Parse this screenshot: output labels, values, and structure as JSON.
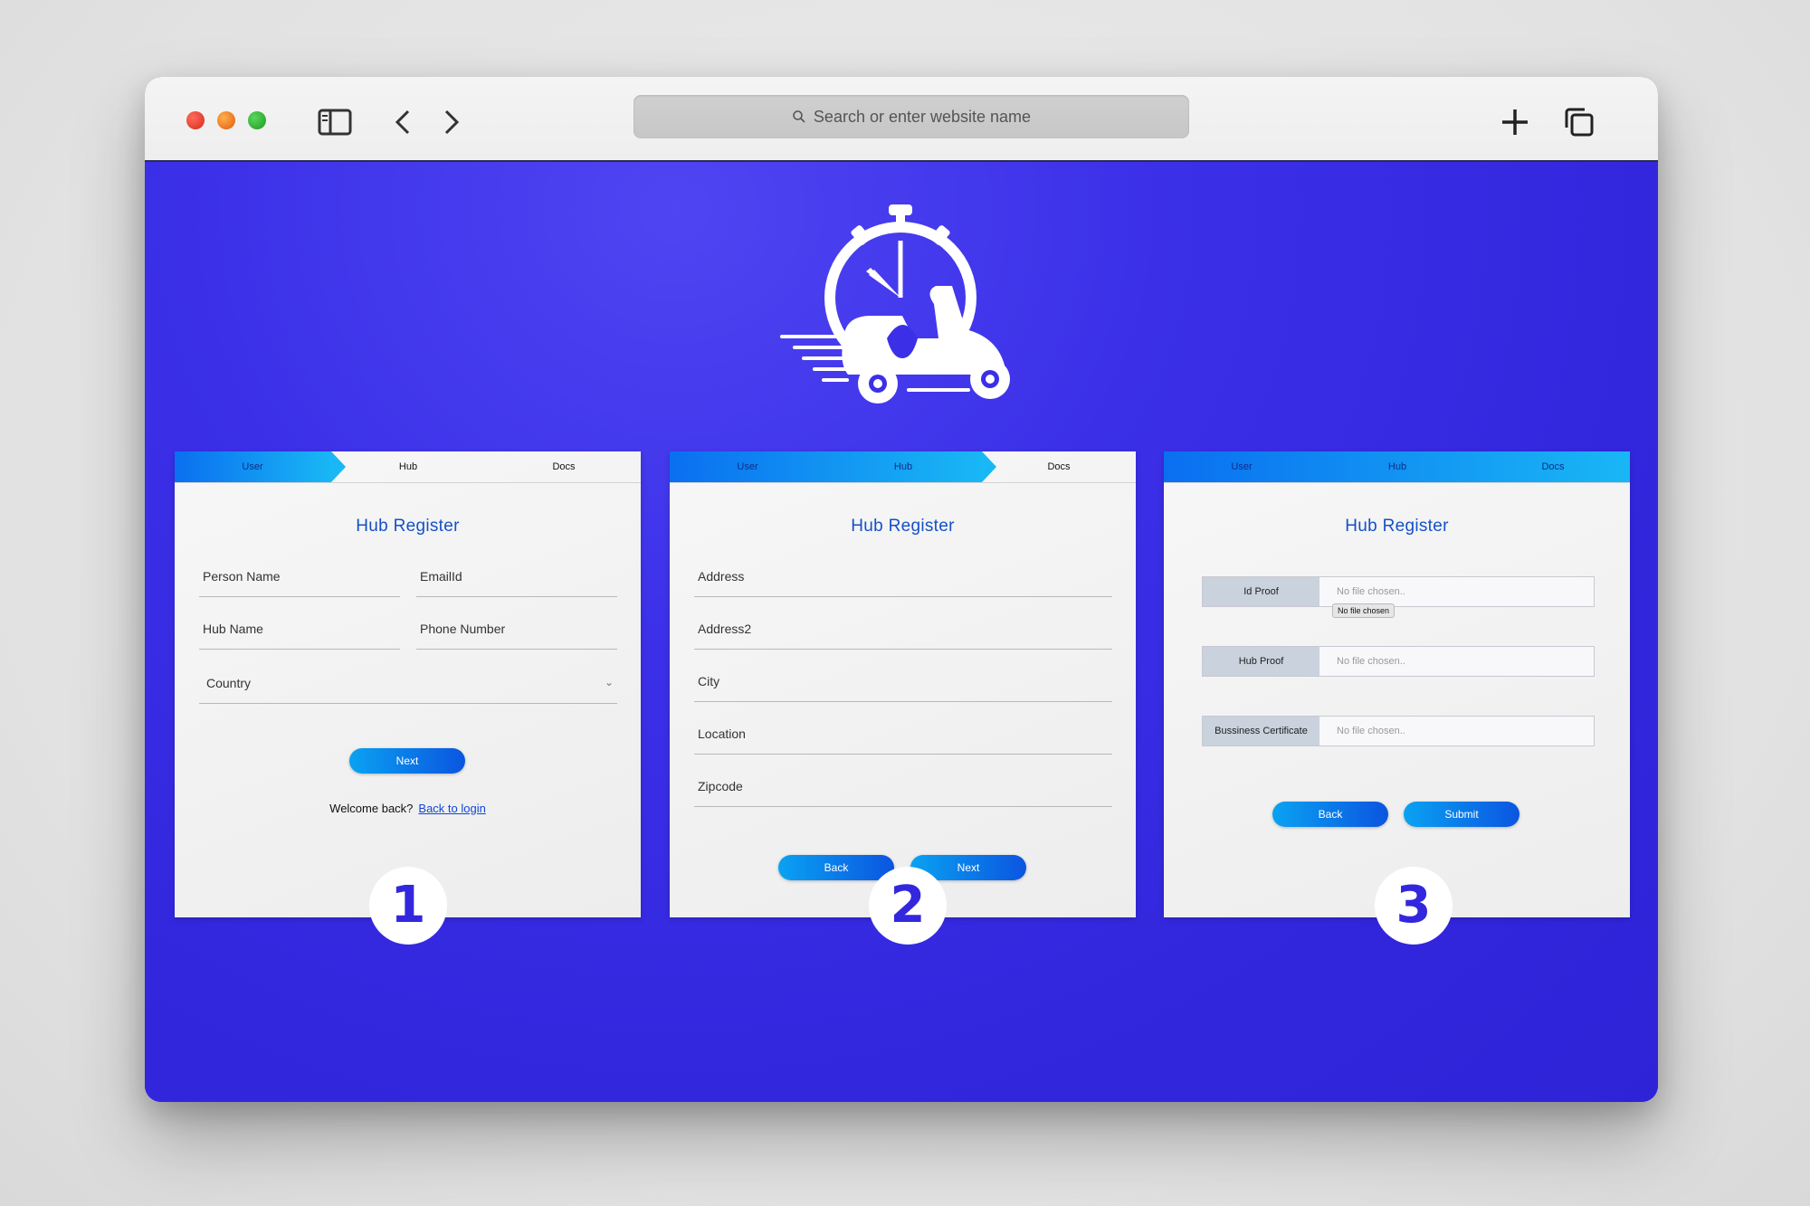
{
  "browser": {
    "address_placeholder": "Search or enter website name"
  },
  "steps": {
    "user": "User",
    "hub": "Hub",
    "docs": "Docs"
  },
  "cards": {
    "title": "Hub Register",
    "step1": {
      "person_name": "Person Name",
      "email": "EmailId",
      "hub_name": "Hub Name",
      "phone": "Phone Number",
      "country": "Country",
      "next": "Next",
      "welcome": "Welcome back?",
      "login_link": "Back to login"
    },
    "step2": {
      "address": "Address",
      "address2": "Address2",
      "city": "City",
      "location": "Location",
      "zipcode": "Zipcode",
      "back": "Back",
      "next": "Next"
    },
    "step3": {
      "id_proof": "Id Proof",
      "hub_proof": "Hub Proof",
      "business_cert": "Bussiness Certificate",
      "no_file": "No file chosen..",
      "tooltip": "No file chosen",
      "back": "Back",
      "submit": "Submit"
    }
  },
  "badges": {
    "one": "1",
    "two": "2",
    "three": "3"
  },
  "colors": {
    "brand": "#3327de",
    "accent": "#0aa2f2",
    "title": "#1550c8"
  }
}
